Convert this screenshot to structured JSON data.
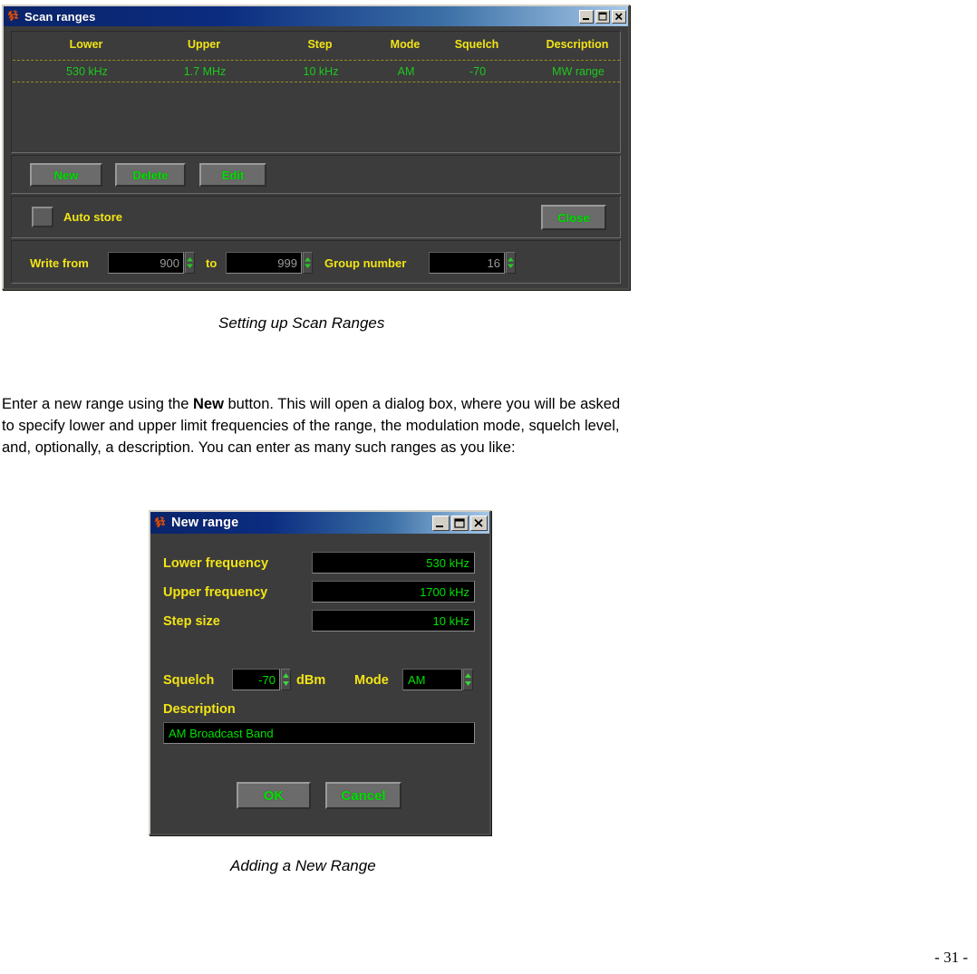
{
  "document": {
    "paragraph_part1": "Enter a new range using the ",
    "paragraph_bold": "New",
    "paragraph_part2": " button. This will open a dialog box, where you will be asked to specify lower and upper limit frequencies of the range, the modulation mode, squelch level, and, optionally, a description. You can enter as many such ranges as you like:",
    "caption_figure1": "Setting up Scan Ranges",
    "caption_figure2": "Adding a New Range",
    "page_number": "- 31 -"
  },
  "colors": {
    "label_yellow": "#f2e415",
    "lcd_green": "#00e000",
    "row_green": "#1ec81e",
    "window_face": "#3c3c3c",
    "titlebar_start": "#0a246a",
    "titlebar_end": "#a6c8e8",
    "icon_orange": "#e2500f"
  },
  "scan_ranges_window": {
    "title": "Scan ranges",
    "title_icon": "app-icon",
    "window_controls": [
      {
        "name": "minimize",
        "glyph": "_"
      },
      {
        "name": "maximize",
        "glyph": "□"
      },
      {
        "name": "close",
        "glyph": "×"
      }
    ],
    "grid": {
      "columns": [
        "Lower",
        "Upper",
        "Step",
        "Mode",
        "Squelch",
        "Description"
      ],
      "column_x": [
        82,
        212,
        340,
        434,
        513,
        624
      ],
      "rows": [
        {
          "lower": "530 kHz",
          "upper": "1.7 MHz",
          "step": "10 kHz",
          "mode": "AM",
          "squelch": "-70",
          "description": "MW range",
          "selected": true
        }
      ]
    },
    "buttons": {
      "new": "New",
      "delete": "Delete",
      "edit": "Edit",
      "close": "Close"
    },
    "auto_store": {
      "label": "Auto store",
      "checked": false
    },
    "write_row": {
      "write_from_label": "Write from",
      "write_from_value": "900",
      "to_label": "to",
      "to_value": "999",
      "group_number_label": "Group number",
      "group_number_value": "16"
    }
  },
  "new_range_window": {
    "title": "New range",
    "title_icon": "app-icon",
    "window_controls": [
      {
        "name": "minimize",
        "glyph": "_"
      },
      {
        "name": "maximize",
        "glyph": "□"
      },
      {
        "name": "close",
        "glyph": "×"
      }
    ],
    "fields": [
      {
        "label": "Lower frequency",
        "value": "530 kHz"
      },
      {
        "label": "Upper frequency",
        "value": "1700 kHz"
      },
      {
        "label": "Step size",
        "value": "10 kHz"
      }
    ],
    "squelch": {
      "label": "Squelch",
      "value": "-70",
      "unit": "dBm"
    },
    "mode": {
      "label": "Mode",
      "value": "AM"
    },
    "description": {
      "label": "Description",
      "value": "AM Broadcast Band"
    },
    "buttons": {
      "ok": "OK",
      "cancel": "Cancel"
    }
  }
}
